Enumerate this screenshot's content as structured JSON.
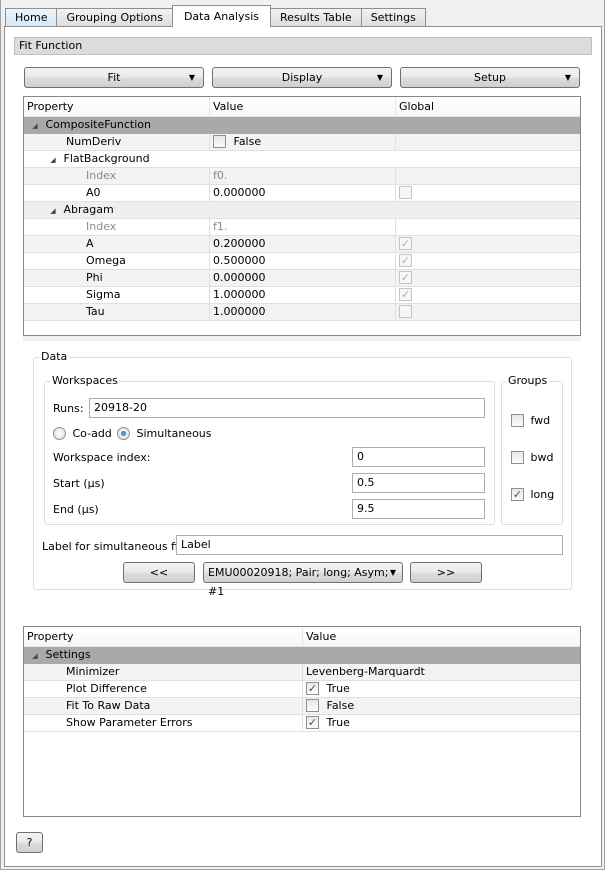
{
  "tabs": [
    {
      "label": "Home",
      "active": false
    },
    {
      "label": "Grouping Options",
      "active": false
    },
    {
      "label": "Data Analysis",
      "active": true
    },
    {
      "label": "Results Table",
      "active": false
    },
    {
      "label": "Settings",
      "active": false
    }
  ],
  "fit_function": {
    "title": "Fit Function",
    "buttons": {
      "fit": "Fit",
      "display": "Display",
      "setup": "Setup"
    },
    "columns": [
      "Property",
      "Value",
      "Global"
    ],
    "composite": "CompositeFunction",
    "numderiv": {
      "name": "NumDeriv",
      "value": "False",
      "checked": false
    },
    "flat_background": {
      "name": "FlatBackground",
      "index": {
        "name": "Index",
        "value": "f0."
      },
      "params": [
        {
          "name": "A0",
          "value": "0.000000",
          "global": false
        }
      ]
    },
    "abragam": {
      "name": "Abragam",
      "index": {
        "name": "Index",
        "value": "f1."
      },
      "params": [
        {
          "name": "A",
          "value": "0.200000",
          "global": true
        },
        {
          "name": "Omega",
          "value": "0.500000",
          "global": true
        },
        {
          "name": "Phi",
          "value": "0.000000",
          "global": true
        },
        {
          "name": "Sigma",
          "value": "1.000000",
          "global": true
        },
        {
          "name": "Tau",
          "value": "1.000000",
          "global": false
        }
      ]
    }
  },
  "data": {
    "title": "Data",
    "workspaces": {
      "title": "Workspaces",
      "runs_label": "Runs:",
      "runs_value": "20918-20",
      "coadd_label": "Co-add",
      "simultaneous_label": "Simultaneous",
      "mode": "simultaneous",
      "ws_index_label": "Workspace index:",
      "ws_index_value": "0",
      "start_label": "Start (µs)",
      "start_value": "0.5",
      "end_label": "End (µs)",
      "end_value": "9.5"
    },
    "groups": {
      "title": "Groups",
      "items": [
        {
          "label": "fwd",
          "checked": false
        },
        {
          "label": "bwd",
          "checked": false
        },
        {
          "label": "long",
          "checked": true
        }
      ]
    },
    "sim_label_text": "Label for simultaneous fit:",
    "sim_label_value": "Label",
    "prev": "<<",
    "next": ">>",
    "dataset_selected": "EMU00020918; Pair; long; Asym; #1"
  },
  "settings": {
    "columns": [
      "Property",
      "Value"
    ],
    "group": "Settings",
    "rows": [
      {
        "name": "Minimizer",
        "value": "Levenberg-Marquardt",
        "type": "text"
      },
      {
        "name": "Plot Difference",
        "value": "True",
        "type": "bool",
        "checked": true
      },
      {
        "name": "Fit To Raw Data",
        "value": "False",
        "type": "bool",
        "checked": false
      },
      {
        "name": "Show Parameter Errors",
        "value": "True",
        "type": "bool",
        "checked": true
      }
    ]
  },
  "help_label": "?",
  "icons": {
    "check": "✓",
    "expand": "◢",
    "dropdown": "▼"
  }
}
